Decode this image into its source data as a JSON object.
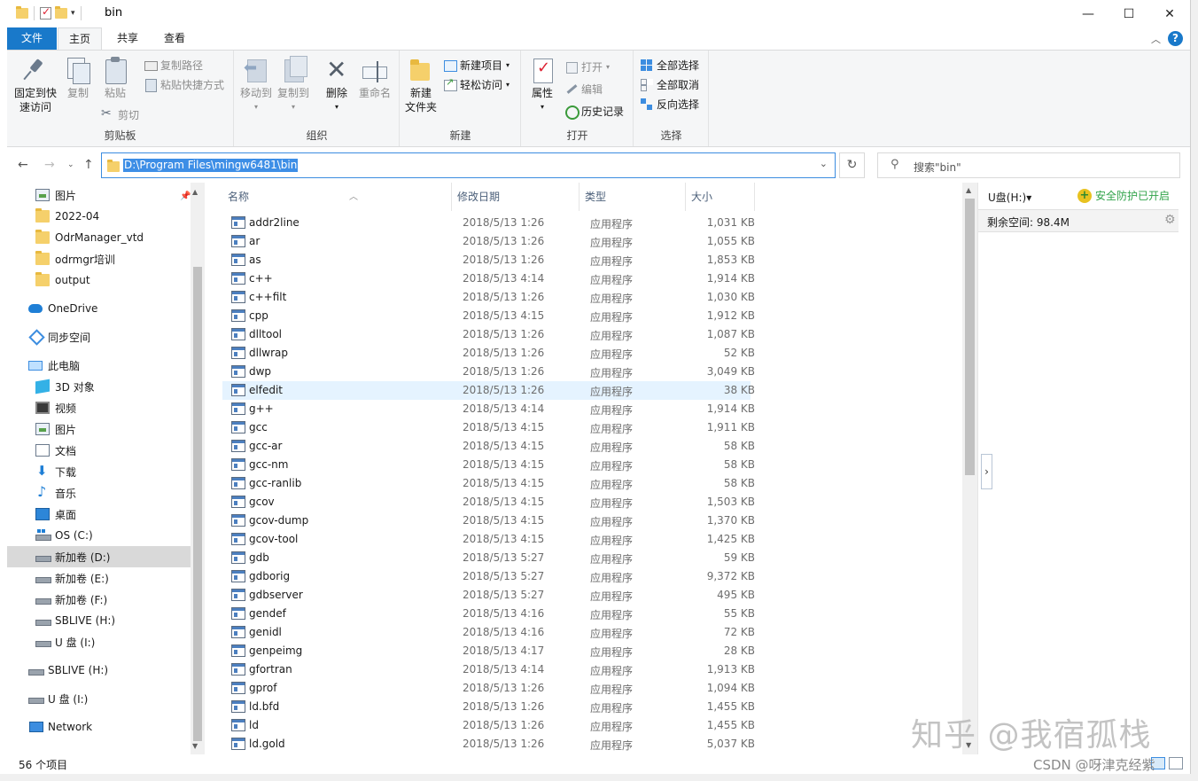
{
  "window": {
    "title": "bin",
    "controls": {
      "minimize": "—",
      "maximize": "☐",
      "close": "✕"
    }
  },
  "ribbon_tabs": [
    "文件",
    "主页",
    "共享",
    "查看"
  ],
  "ribbon": {
    "clipboard": {
      "label": "剪贴板",
      "pin": "固定到快\n速访问",
      "pin_l1": "固定到快",
      "pin_l2": "速访问",
      "copy": "复制",
      "paste": "粘贴",
      "copy_path": "复制路径",
      "paste_shortcut": "粘贴快捷方式",
      "cut": "剪切"
    },
    "organize": {
      "label": "组织",
      "move_to": "移动到",
      "copy_to": "复制到",
      "delete": "删除",
      "rename": "重命名"
    },
    "new": {
      "label": "新建",
      "new_folder_l1": "新建",
      "new_folder_l2": "文件夹",
      "new_item": "新建项目",
      "easy_access": "轻松访问"
    },
    "open": {
      "label": "打开",
      "properties": "属性",
      "open": "打开",
      "edit": "编辑",
      "history": "历史记录"
    },
    "select": {
      "label": "选择",
      "select_all": "全部选择",
      "select_none": "全部取消",
      "invert": "反向选择"
    }
  },
  "address": {
    "path": "D:\\Program Files\\mingw6481\\bin",
    "search_placeholder": "搜索\"bin\""
  },
  "nav_tree": [
    {
      "label": "图片",
      "icon": "pictures-icon",
      "indent": 1,
      "pinned": true
    },
    {
      "label": "2022-04",
      "icon": "folder-icon",
      "indent": 1
    },
    {
      "label": "OdrManager_vtd",
      "icon": "folder-icon",
      "indent": 1
    },
    {
      "label": "odrmgr培训",
      "icon": "folder-icon",
      "indent": 1
    },
    {
      "label": "output",
      "icon": "folder-icon",
      "indent": 1
    },
    {
      "label": "OneDrive",
      "icon": "onedrive-icon",
      "indent": 0
    },
    {
      "label": "同步空间",
      "icon": "sync-icon",
      "indent": 0
    },
    {
      "label": "此电脑",
      "icon": "pc-icon",
      "indent": 0
    },
    {
      "label": "3D 对象",
      "icon": "3d-objects-icon",
      "indent": 1
    },
    {
      "label": "视频",
      "icon": "video-icon",
      "indent": 1
    },
    {
      "label": "图片",
      "icon": "pictures-icon",
      "indent": 1
    },
    {
      "label": "文档",
      "icon": "document-icon",
      "indent": 1
    },
    {
      "label": "下载",
      "icon": "download-icon",
      "indent": 1
    },
    {
      "label": "音乐",
      "icon": "music-icon",
      "indent": 1
    },
    {
      "label": "桌面",
      "icon": "desktop-icon",
      "indent": 1
    },
    {
      "label": "OS (C:)",
      "icon": "os-drive-icon",
      "indent": 1
    },
    {
      "label": "新加卷 (D:)",
      "icon": "drive-icon",
      "indent": 1,
      "selected": true
    },
    {
      "label": "新加卷 (E:)",
      "icon": "drive-icon",
      "indent": 1
    },
    {
      "label": "新加卷 (F:)",
      "icon": "drive-icon",
      "indent": 1
    },
    {
      "label": "SBLIVE (H:)",
      "icon": "drive-icon",
      "indent": 1
    },
    {
      "label": "U 盘 (I:)",
      "icon": "drive-icon",
      "indent": 1
    },
    {
      "label": "SBLIVE (H:)",
      "icon": "drive-icon",
      "indent": 0
    },
    {
      "label": "U 盘 (I:)",
      "icon": "drive-icon",
      "indent": 0
    },
    {
      "label": "Network",
      "icon": "network-icon",
      "indent": 0
    }
  ],
  "columns": {
    "name": "名称",
    "date": "修改日期",
    "type": "类型",
    "size": "大小"
  },
  "files": [
    {
      "name": "addr2line",
      "date": "2018/5/13 1:26",
      "type": "应用程序",
      "size": "1,031 KB"
    },
    {
      "name": "ar",
      "date": "2018/5/13 1:26",
      "type": "应用程序",
      "size": "1,055 KB"
    },
    {
      "name": "as",
      "date": "2018/5/13 1:26",
      "type": "应用程序",
      "size": "1,853 KB"
    },
    {
      "name": "c++",
      "date": "2018/5/13 4:14",
      "type": "应用程序",
      "size": "1,914 KB"
    },
    {
      "name": "c++filt",
      "date": "2018/5/13 1:26",
      "type": "应用程序",
      "size": "1,030 KB"
    },
    {
      "name": "cpp",
      "date": "2018/5/13 4:15",
      "type": "应用程序",
      "size": "1,912 KB"
    },
    {
      "name": "dlltool",
      "date": "2018/5/13 1:26",
      "type": "应用程序",
      "size": "1,087 KB"
    },
    {
      "name": "dllwrap",
      "date": "2018/5/13 1:26",
      "type": "应用程序",
      "size": "52 KB"
    },
    {
      "name": "dwp",
      "date": "2018/5/13 1:26",
      "type": "应用程序",
      "size": "3,049 KB"
    },
    {
      "name": "elfedit",
      "date": "2018/5/13 1:26",
      "type": "应用程序",
      "size": "38 KB",
      "hover": true
    },
    {
      "name": "g++",
      "date": "2018/5/13 4:14",
      "type": "应用程序",
      "size": "1,914 KB"
    },
    {
      "name": "gcc",
      "date": "2018/5/13 4:15",
      "type": "应用程序",
      "size": "1,911 KB"
    },
    {
      "name": "gcc-ar",
      "date": "2018/5/13 4:15",
      "type": "应用程序",
      "size": "58 KB"
    },
    {
      "name": "gcc-nm",
      "date": "2018/5/13 4:15",
      "type": "应用程序",
      "size": "58 KB"
    },
    {
      "name": "gcc-ranlib",
      "date": "2018/5/13 4:15",
      "type": "应用程序",
      "size": "58 KB"
    },
    {
      "name": "gcov",
      "date": "2018/5/13 4:15",
      "type": "应用程序",
      "size": "1,503 KB"
    },
    {
      "name": "gcov-dump",
      "date": "2018/5/13 4:15",
      "type": "应用程序",
      "size": "1,370 KB"
    },
    {
      "name": "gcov-tool",
      "date": "2018/5/13 4:15",
      "type": "应用程序",
      "size": "1,425 KB"
    },
    {
      "name": "gdb",
      "date": "2018/5/13 5:27",
      "type": "应用程序",
      "size": "59 KB"
    },
    {
      "name": "gdborig",
      "date": "2018/5/13 5:27",
      "type": "应用程序",
      "size": "9,372 KB"
    },
    {
      "name": "gdbserver",
      "date": "2018/5/13 5:27",
      "type": "应用程序",
      "size": "495 KB"
    },
    {
      "name": "gendef",
      "date": "2018/5/13 4:16",
      "type": "应用程序",
      "size": "55 KB"
    },
    {
      "name": "genidl",
      "date": "2018/5/13 4:16",
      "type": "应用程序",
      "size": "72 KB"
    },
    {
      "name": "genpeimg",
      "date": "2018/5/13 4:17",
      "type": "应用程序",
      "size": "28 KB"
    },
    {
      "name": "gfortran",
      "date": "2018/5/13 4:14",
      "type": "应用程序",
      "size": "1,913 KB"
    },
    {
      "name": "gprof",
      "date": "2018/5/13 1:26",
      "type": "应用程序",
      "size": "1,094 KB"
    },
    {
      "name": "ld.bfd",
      "date": "2018/5/13 1:26",
      "type": "应用程序",
      "size": "1,455 KB"
    },
    {
      "name": "ld",
      "date": "2018/5/13 1:26",
      "type": "应用程序",
      "size": "1,455 KB"
    },
    {
      "name": "ld.gold",
      "date": "2018/5/13 1:26",
      "type": "应用程序",
      "size": "5,037 KB"
    }
  ],
  "right_panel": {
    "drive": "U盘(H:)▾",
    "security": "安全防护已开启",
    "free_space": "剩余空间: 98.4M"
  },
  "status": {
    "item_count": "56 个项目"
  },
  "watermarks": {
    "zhihu": "知乎 @我宿孤栈",
    "csdn": "CSDN @呀津克经紫"
  },
  "colors": {
    "accent": "#1979ca",
    "selection": "#3d8ee6",
    "hover_row": "#e5f3ff",
    "security_green": "#31a34a"
  }
}
